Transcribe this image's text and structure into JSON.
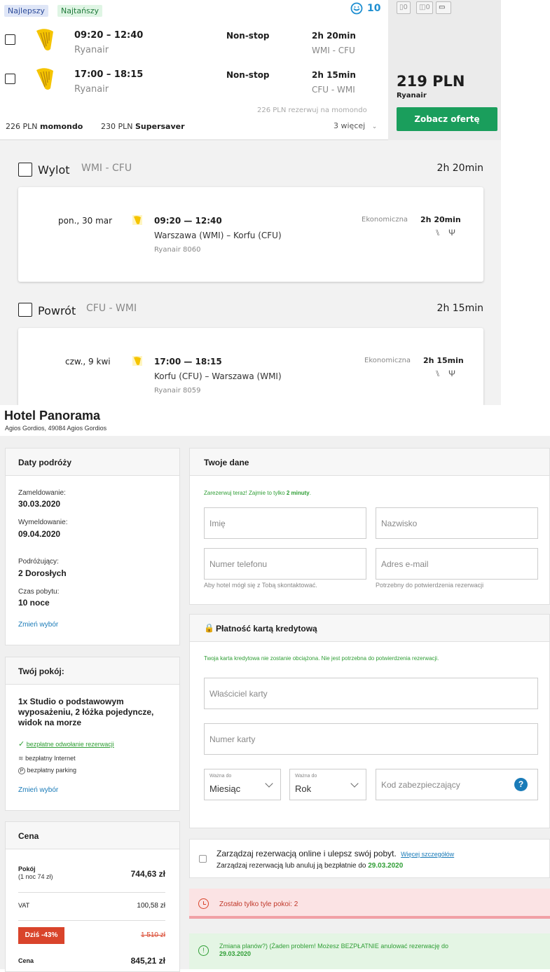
{
  "flight_card": {
    "tags": [
      "Najlepszy",
      "Najtańszy"
    ],
    "rating": "10",
    "legs": [
      {
        "times": "09:20 – 12:40",
        "airline": "Ryanair",
        "stops": "Non-stop",
        "duration": "2h 20min",
        "route": "WMI - CFU"
      },
      {
        "times": "17:00 – 18:15",
        "airline": "Ryanair",
        "stops": "Non-stop",
        "duration": "2h 15min",
        "route": "CFU - WMI"
      }
    ],
    "alt_offer_note": "226 PLN rezerwuj na momondo",
    "other_offers": [
      {
        "price": "226 PLN",
        "provider": "momondo"
      },
      {
        "price": "230 PLN",
        "provider": "Supersaver"
      }
    ],
    "more_link": "3 więcej",
    "bag_counts": [
      "0",
      "0"
    ],
    "price": "219 PLN",
    "price_provider": "Ryanair",
    "cta": "Zobacz ofertę",
    "accent_green": "#1a9e5c"
  },
  "flight_details": [
    {
      "title": "Wylot",
      "route": "WMI - CFU",
      "duration": "2h 20min",
      "date": "pon., 30 mar",
      "times": "09:20 — 12:40",
      "places": "Warszawa (WMI) – Korfu (CFU)",
      "flight_no": "Ryanair 8060",
      "class": "Ekonomiczna",
      "class_duration": "2h 20min"
    },
    {
      "title": "Powrót",
      "route": "CFU - WMI",
      "duration": "2h 15min",
      "date": "czw., 9 kwi",
      "times": "17:00 — 18:15",
      "places": "Korfu (CFU) – Warszawa (WMI)",
      "flight_no": "Ryanair 8059",
      "class": "Ekonomiczna",
      "class_duration": "2h 15min"
    }
  ],
  "hotel": {
    "name": "Hotel Panorama",
    "address": "Agios Gordios, 49084 Agios Gordios",
    "dates_panel": {
      "title": "Daty podróży",
      "checkin_label": "Zameldowanie:",
      "checkin": "30.03.2020",
      "checkout_label": "Wymeldowanie:",
      "checkout": "09.04.2020",
      "travelers_label": "Podróżujący:",
      "travelers": "2 Dorosłych",
      "stay_label": "Czas pobytu:",
      "stay": "10 noce",
      "change": "Zmień wybór"
    },
    "room_panel": {
      "title": "Twój pokój:",
      "room": "1x Studio o podstawowym wyposażeniu, 2 łóżka pojedyncze, widok na morze",
      "features": [
        "bezpłatne odwołanie rezerwacji",
        "bezpłatny Internet",
        "bezpłatny parking"
      ],
      "change": "Zmień wybór"
    },
    "price_panel": {
      "title": "Cena",
      "room_label": "Pokój",
      "room_sub": "(1 noc 74 zł)",
      "room_price": "744,63 zł",
      "vat_label": "VAT",
      "vat": "100,58 zł",
      "discount_badge": "Dziś -43%",
      "old_price": "1 510 zł",
      "total_label": "Cena",
      "total": "845,21 zł"
    },
    "form": {
      "title": "Twoje dane",
      "intro": "Zarezerwuj teraz! Zajmie to tylko ",
      "intro_bold": "2 minuty",
      "intro_end": ".",
      "first_name": "Imię",
      "last_name": "Nazwisko",
      "phone": "Numer telefonu",
      "email": "Adres e-mail",
      "phone_hint": "Aby hotel mógł się z Tobą skontaktować.",
      "email_hint": "Potrzebny do potwierdzenia rezerwacji"
    },
    "payment": {
      "title": "Płatność kartą kredytową",
      "note": "Twoja karta kredytowa nie zostanie obciążona. Nie jest potrzebna do potwierdzenia rezerwacji.",
      "holder": "Właściciel karty",
      "number": "Numer karty",
      "valid_label": "Ważna do",
      "month": "Miesiąc",
      "year": "Rok",
      "cvc": "Kod zabezpieczający"
    },
    "manage": {
      "text": "Zarządzaj rezerwacją online i ulepsz swój pobyt.",
      "more": "Więcej szczegółów",
      "sub": "Zarządzaj rezerwacją lub anuluj ją bezpłatnie do ",
      "sub_date": "29.03.2020"
    },
    "alert_rooms": "Zostało tylko tyle pokoi: 2",
    "alert_cancel": "Zmiana planów?) (Żaden problem! Możesz BEZPŁATNIE anulować rezerwację do ",
    "alert_cancel_date": "29.03.2020"
  }
}
